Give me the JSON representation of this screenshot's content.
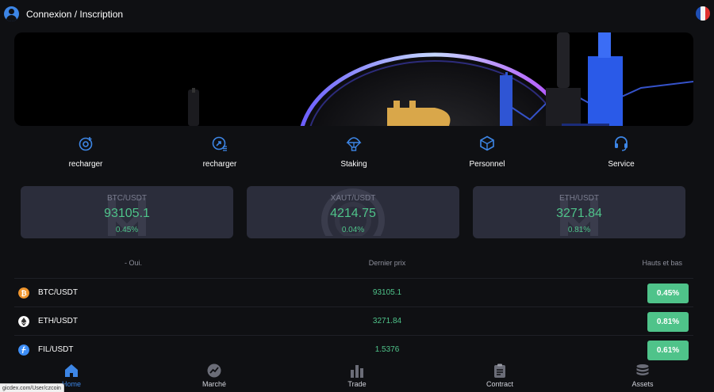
{
  "header": {
    "title": "Connexion / Inscription"
  },
  "actions": [
    {
      "label": "recharger",
      "icon": "deposit-icon"
    },
    {
      "label": "recharger",
      "icon": "withdraw-icon"
    },
    {
      "label": "Staking",
      "icon": "staking-icon"
    },
    {
      "label": "Personnel",
      "icon": "personal-icon"
    },
    {
      "label": "Service",
      "icon": "headset-icon"
    }
  ],
  "tickers": [
    {
      "pair": "BTC/USDT",
      "price": "93105.1",
      "change": "0.45%"
    },
    {
      "pair": "XAUT/USDT",
      "price": "4214.75",
      "change": "0.04%"
    },
    {
      "pair": "ETH/USDT",
      "price": "3271.84",
      "change": "0.81%"
    }
  ],
  "table": {
    "headers": {
      "name": "- Oui.",
      "last": "Dernier prix",
      "change": "Hauts et bas"
    },
    "rows": [
      {
        "symbol": "BTC/USDT",
        "last": "93105.1",
        "change": "0.45%",
        "icon": "btc-icon",
        "icon_color": "#f0962e"
      },
      {
        "symbol": "ETH/USDT",
        "last": "3271.84",
        "change": "0.81%",
        "icon": "eth-icon",
        "icon_color": "#ffffff"
      },
      {
        "symbol": "FIL/USDT",
        "last": "1.5376",
        "change": "0.61%",
        "icon": "fil-icon",
        "icon_color": "#3d8ef7"
      }
    ]
  },
  "nav": [
    {
      "label": "Home",
      "icon": "home-icon",
      "active": true
    },
    {
      "label": "Marché",
      "icon": "market-icon"
    },
    {
      "label": "Trade",
      "icon": "trade-icon"
    },
    {
      "label": "Contract",
      "icon": "contract-icon"
    },
    {
      "label": "Assets",
      "icon": "assets-icon"
    }
  ],
  "status_url": "gicdex.com/User/czcoin",
  "colors": {
    "background": "#0f1013",
    "accent": "#3d86e6",
    "up": "#4fc38a",
    "card": "#2b2d3b"
  }
}
